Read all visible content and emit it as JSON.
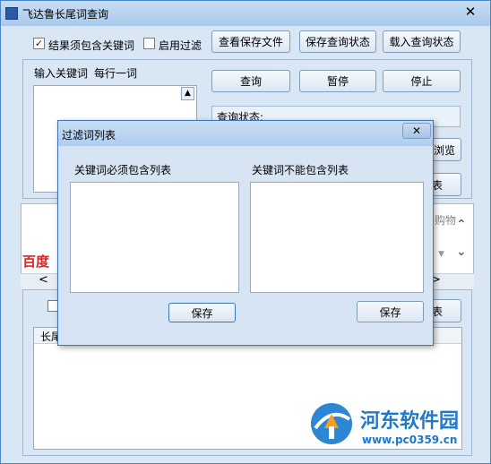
{
  "window": {
    "title": "飞达鲁长尾词查询",
    "close": "✕"
  },
  "options": {
    "require_keyword_label": "结果须包含关键词",
    "require_keyword_checked": "✓",
    "enable_filter_label": "启用过滤"
  },
  "toolbar": {
    "view_saved": "查看保存文件",
    "save_state": "保存查询状态",
    "load_state": "载入查询状态"
  },
  "input": {
    "label": "输入关键词",
    "hint": "每行一词"
  },
  "actions": {
    "query": "查询",
    "pause": "暂停",
    "stop": "停止"
  },
  "status": {
    "label": "查询状态:"
  },
  "hidden_partial": {
    "browse_fragment": "浏览",
    "list_fragment_1": "表",
    "list_fragment_2": "表",
    "goods_fragment": "购物",
    "column_fragment": "长尾"
  },
  "baidu": {
    "logo": "百度",
    "nav_left": "<",
    "nav_right": ">"
  },
  "dialog": {
    "title": "过滤词列表",
    "close": "✕",
    "must_include_label": "关键词必须包含列表",
    "must_exclude_label": "关键词不能包含列表",
    "save_left": "保存",
    "save_right": "保存"
  },
  "watermark": {
    "name": "河东软件园",
    "url": "www.pc0359.cn"
  }
}
